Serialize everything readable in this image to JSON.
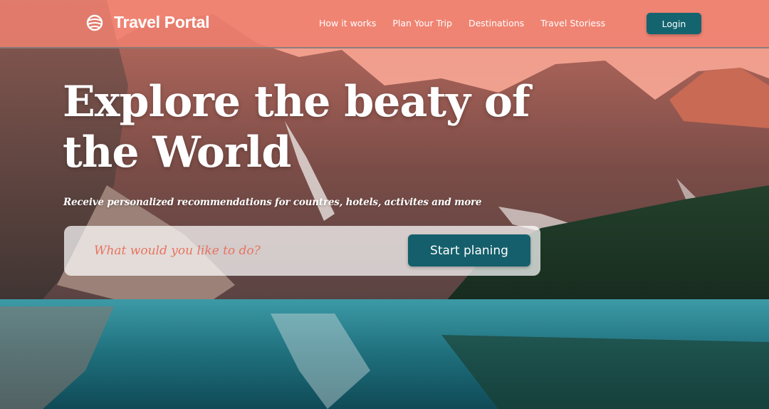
{
  "brand": {
    "name": "Travel Portal",
    "icon": "globe-icon"
  },
  "nav": {
    "links": [
      "How it works",
      "Plan Your Trip",
      "Destinations",
      "Travel Storiess"
    ],
    "login_label": "Login"
  },
  "hero": {
    "title": "Explore the beaty of the World",
    "subtitle": "Receive personalized recommendations for countres, hotels, activites and more"
  },
  "search": {
    "placeholder": "What would you like to do?",
    "value": "",
    "button_label": "Start planing"
  },
  "colors": {
    "navbar": "#f08070",
    "primary_button": "#146470",
    "placeholder_text": "#e8735f"
  }
}
